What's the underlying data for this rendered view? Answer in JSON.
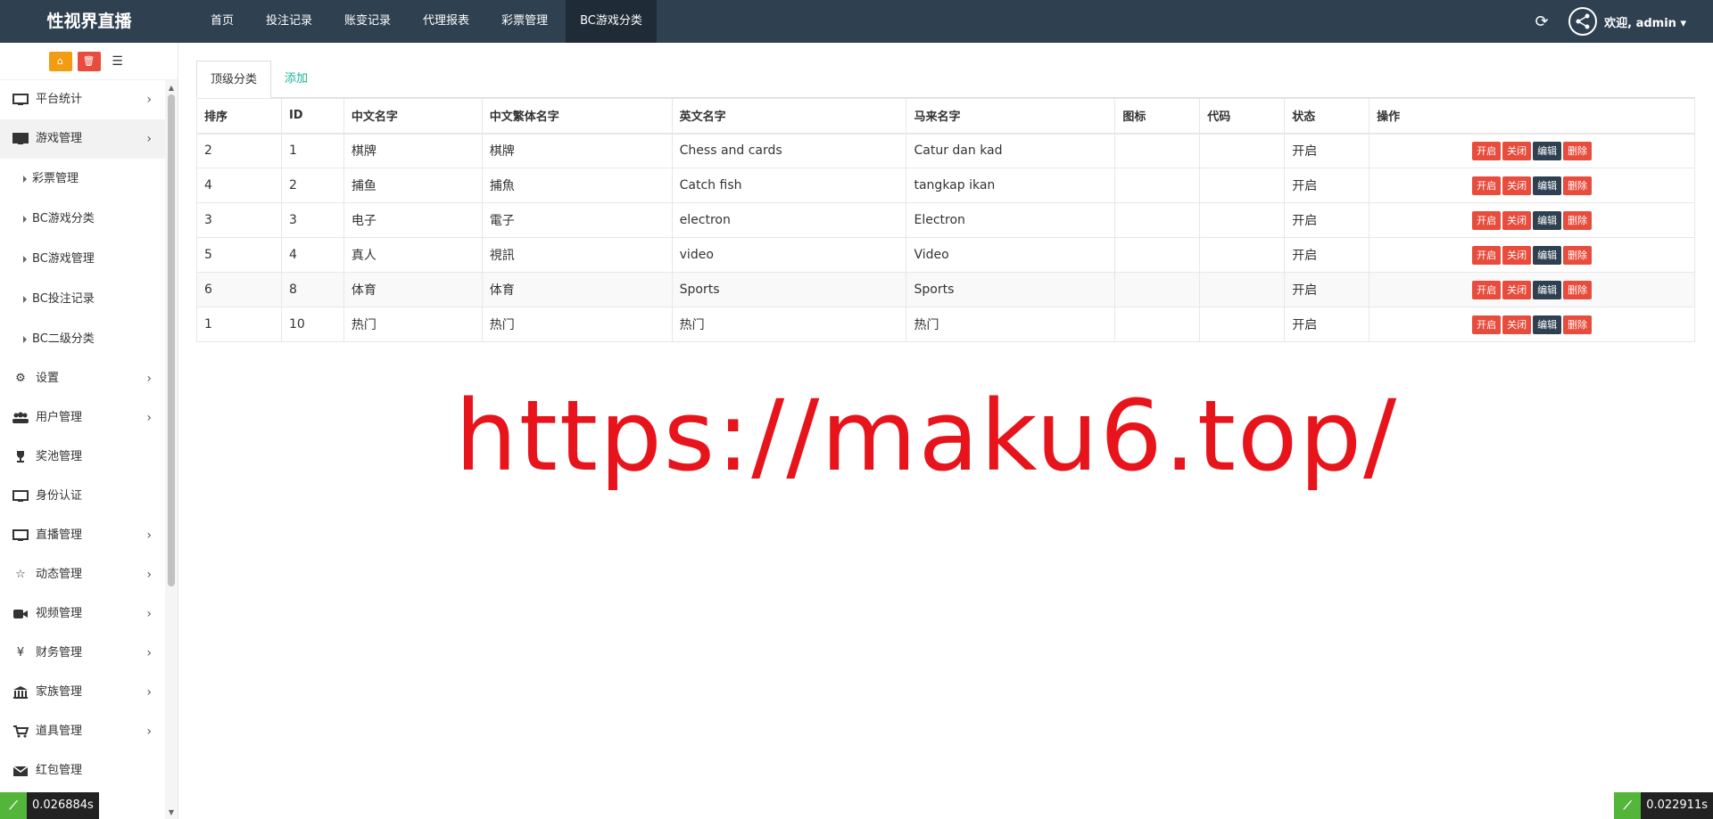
{
  "brand": "性视界直播",
  "nav": [
    {
      "label": "首页",
      "active": false
    },
    {
      "label": "投注记录",
      "active": false
    },
    {
      "label": "账变记录",
      "active": false
    },
    {
      "label": "代理报表",
      "active": false
    },
    {
      "label": "彩票管理",
      "active": false
    },
    {
      "label": "BC游戏分类",
      "active": true
    }
  ],
  "top_right": {
    "welcome": "欢迎, admin ▾"
  },
  "sidebar": {
    "items": [
      {
        "label": "平台统计",
        "icon": "monitor-icon",
        "chevron": true
      },
      {
        "label": "游戏管理",
        "icon": "monitor-icon",
        "chevron": true,
        "active": true
      },
      {
        "label": "设置",
        "icon": "gears-icon",
        "chevron": true
      },
      {
        "label": "用户管理",
        "icon": "users-icon",
        "chevron": true
      },
      {
        "label": "奖池管理",
        "icon": "trophy-icon",
        "chevron": false
      },
      {
        "label": "身份认证",
        "icon": "monitor-icon",
        "chevron": false
      },
      {
        "label": "直播管理",
        "icon": "monitor-icon",
        "chevron": true
      },
      {
        "label": "动态管理",
        "icon": "star-icon",
        "chevron": true
      },
      {
        "label": "视频管理",
        "icon": "video-camera-icon",
        "chevron": true
      },
      {
        "label": "财务管理",
        "icon": "yen-icon",
        "chevron": true
      },
      {
        "label": "家族管理",
        "icon": "bank-icon",
        "chevron": true
      },
      {
        "label": "道具管理",
        "icon": "cart-icon",
        "chevron": true
      },
      {
        "label": "红包管理",
        "icon": "envelope-icon",
        "chevron": false
      }
    ],
    "subitems": [
      "彩票管理",
      "BC游戏分类",
      "BC游戏管理",
      "BC投注记录",
      "BC二级分类"
    ]
  },
  "tabs": {
    "active": "顶级分类",
    "add": "添加"
  },
  "table": {
    "headers": [
      "排序",
      "ID",
      "中文名字",
      "中文繁体名字",
      "英文名字",
      "马来名字",
      "图标",
      "代码",
      "状态",
      "操作"
    ],
    "rows": [
      [
        "2",
        "1",
        "棋牌",
        "棋牌",
        "Chess and cards",
        "Catur dan kad",
        "",
        "",
        "开启"
      ],
      [
        "4",
        "2",
        "捕鱼",
        "捕魚",
        "Catch fish",
        "tangkap ikan",
        "",
        "",
        "开启"
      ],
      [
        "3",
        "3",
        "电子",
        "電子",
        "electron",
        "Electron",
        "",
        "",
        "开启"
      ],
      [
        "5",
        "4",
        "真人",
        "視訊",
        "video",
        "Video",
        "",
        "",
        "开启"
      ],
      [
        "6",
        "8",
        "体育",
        "体育",
        "Sports",
        "Sports",
        "",
        "",
        "开启"
      ],
      [
        "1",
        "10",
        "热门",
        "热门",
        "热门",
        "热门",
        "",
        "",
        "开启"
      ]
    ],
    "ops": {
      "open": "开启",
      "close": "关闭",
      "edit": "编辑",
      "delete": "删除"
    }
  },
  "watermark": "https://maku6.top/",
  "timers": {
    "left": "0.026884s",
    "right": "0.022911s"
  },
  "colors": {
    "topbar": "#2f4050",
    "danger": "#e74c3c",
    "link": "#1ab394",
    "watermark": "#e8141c"
  }
}
